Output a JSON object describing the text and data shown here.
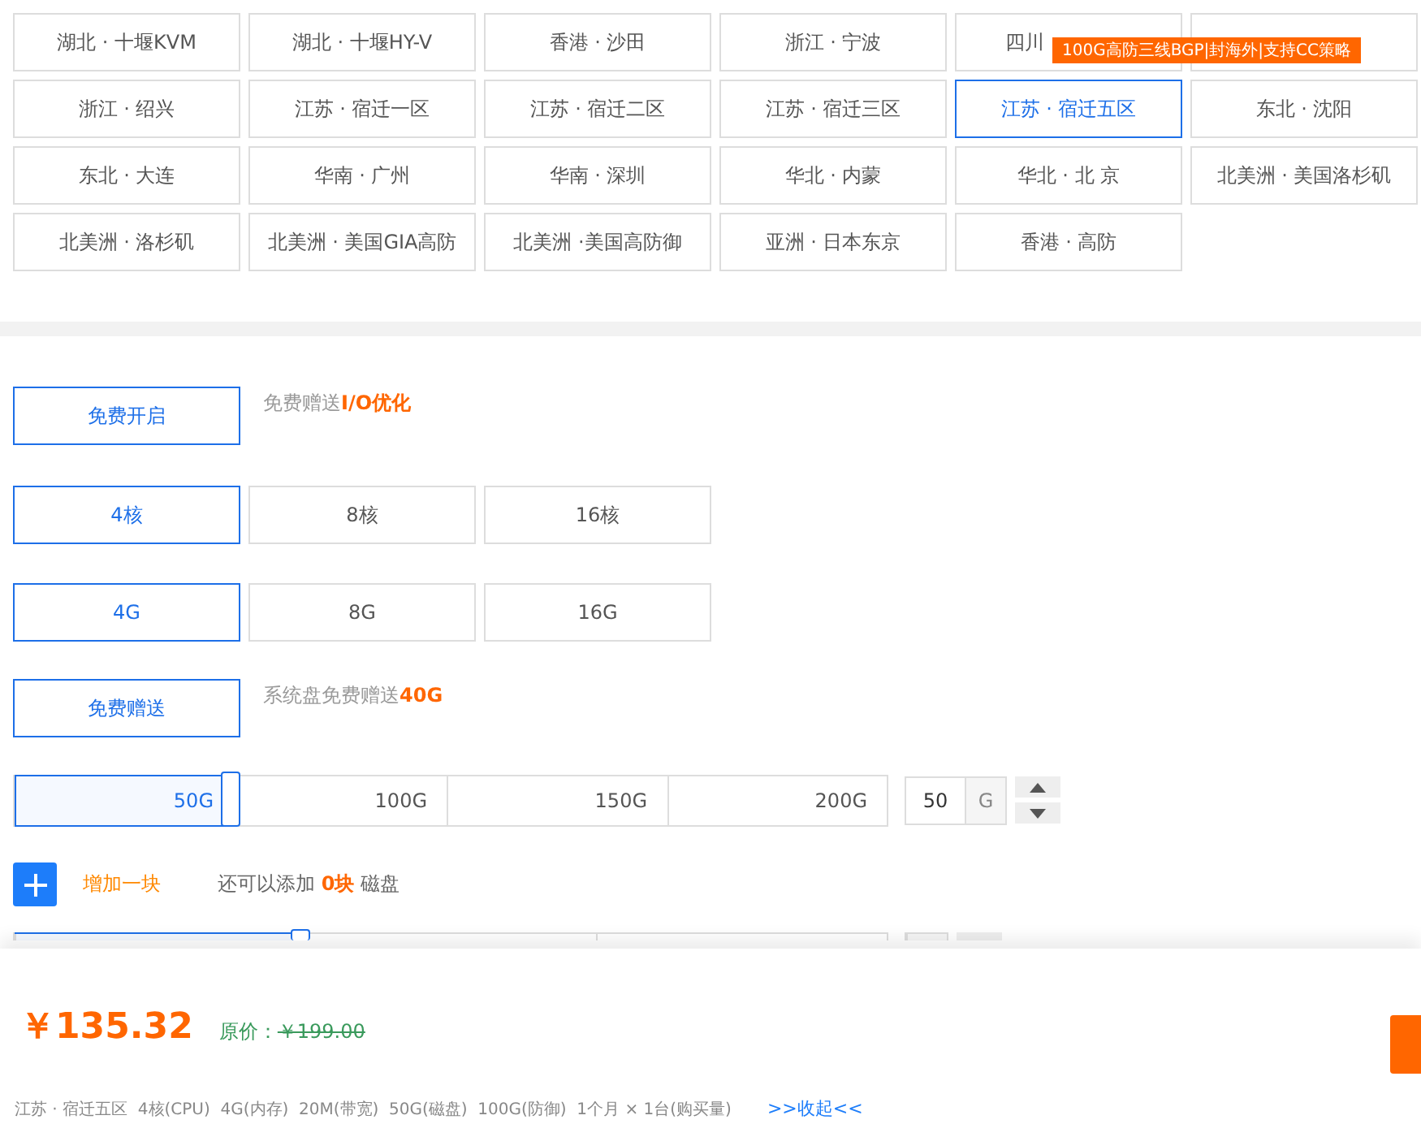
{
  "regions": [
    {
      "label": "湖北 · 十堰KVM",
      "selected": false
    },
    {
      "label": "湖北 · 十堰HY-V",
      "selected": false
    },
    {
      "label": "香港 · 沙田",
      "selected": false
    },
    {
      "label": "浙江 · 宁波",
      "selected": false
    },
    {
      "label": "四川",
      "selected": false,
      "tooltip": "100G高防三线BGP|封海外|支持CC策略"
    },
    {
      "selected": false
    },
    {
      "label": "浙江 · 绍兴",
      "selected": false
    },
    {
      "label": "江苏 · 宿迁一区",
      "selected": false
    },
    {
      "label": "江苏 · 宿迁二区",
      "selected": false
    },
    {
      "label": "江苏 · 宿迁三区",
      "selected": false
    },
    {
      "label": "江苏 · 宿迁五区",
      "selected": true
    },
    {
      "label": "东北 · 沈阳",
      "selected": false
    },
    {
      "label": "东北 · 大连",
      "selected": false
    },
    {
      "label": "华南 · 广州",
      "selected": false
    },
    {
      "label": "华南 · 深圳",
      "selected": false
    },
    {
      "label": "华北 · 内蒙",
      "selected": false
    },
    {
      "label": "华北 · 北 京",
      "selected": false
    },
    {
      "label": "北美洲 · 美国洛杉矶",
      "selected": false
    },
    {
      "label": "北美洲 · 洛杉矶",
      "selected": false
    },
    {
      "label": "北美洲 · 美国GIA高防",
      "selected": false
    },
    {
      "label": "北美洲 ·美国高防御",
      "selected": false
    },
    {
      "label": "亚洲 · 日本东京",
      "selected": false
    },
    {
      "label": "香港 · 高防",
      "selected": false
    }
  ],
  "io": {
    "options": [
      {
        "label": "免费开启",
        "selected": true
      }
    ],
    "note": "免费赠送**I/O优化**"
  },
  "cpu": {
    "options": [
      {
        "label": "4核",
        "selected": true
      },
      {
        "label": "8核",
        "selected": false
      },
      {
        "label": "16核",
        "selected": false
      }
    ]
  },
  "memory": {
    "options": [
      {
        "label": "4G",
        "selected": true
      },
      {
        "label": "8G",
        "selected": false
      },
      {
        "label": "16G",
        "selected": false
      }
    ]
  },
  "system_disk": {
    "options": [
      {
        "label": "免费赠送",
        "selected": true
      }
    ],
    "note": "系统盘免费赠送**40G**"
  },
  "data_disks": [
    {
      "level": 0.25,
      "ticks": [
        "50G",
        "100G",
        "150G",
        "200G"
      ],
      "value": "50",
      "unit": "G"
    },
    {
      "level": 0.33
    }
  ],
  "add_disk": {
    "label": "增加一块",
    "note": "还可以添加 **0块** 磁盘"
  },
  "footer": {
    "price": "￥135.32",
    "original_label": "原价：",
    "original_price": "￥199.00",
    "summary": "江苏 · 宿迁五区  4核(CPU)  4G(内存)  20M(带宽)  50G(磁盘)  100G(防御)  1个月 × 1台(购买量)",
    "collapse": ">>收起<<"
  }
}
